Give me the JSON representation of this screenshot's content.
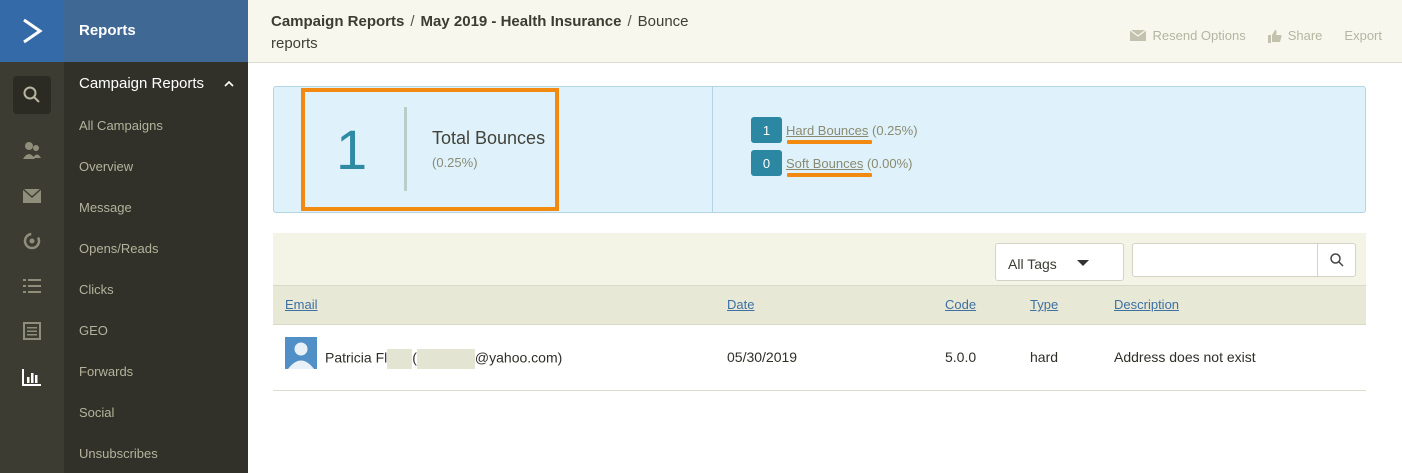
{
  "app": {
    "logo_icon": "chevron-right-logo",
    "accent_color": "#356aa8",
    "highlight_color": "#f28a12"
  },
  "rail": {
    "icons": [
      "search-icon",
      "contacts-icon",
      "mail-icon",
      "automation-icon",
      "list-icon",
      "forms-icon",
      "reports-icon"
    ]
  },
  "sidebar": {
    "title": "Reports",
    "section_label": "Campaign Reports",
    "items": [
      {
        "label": "All Campaigns"
      },
      {
        "label": "Overview"
      },
      {
        "label": "Message"
      },
      {
        "label": "Opens/Reads"
      },
      {
        "label": "Clicks"
      },
      {
        "label": "GEO"
      },
      {
        "label": "Forwards"
      },
      {
        "label": "Social"
      },
      {
        "label": "Unsubscribes"
      }
    ]
  },
  "header": {
    "breadcrumb": {
      "first": "Campaign Reports",
      "second": "May 2019 - Health Insurance",
      "third": "Bounce reports",
      "separator": "/"
    },
    "actions": {
      "resend": "Resend Options",
      "share": "Share",
      "export": "Export"
    }
  },
  "summary": {
    "total_count": "1",
    "total_label": "Total Bounces",
    "total_pct": "(0.25%)",
    "hard_count": "1",
    "hard_label": "Hard Bounces",
    "hard_pct": "(0.25%)",
    "soft_count": "0",
    "soft_label": "Soft Bounces",
    "soft_pct": "(0.00%)"
  },
  "filters": {
    "tags_selected": "All Tags",
    "search_value": ""
  },
  "table": {
    "columns": {
      "email": "Email",
      "date": "Date",
      "code": "Code",
      "type": "Type",
      "description": "Description"
    },
    "rows": [
      {
        "name_prefix": "Patricia Fl",
        "paren_open": "(",
        "email_suffix": "@yahoo.com)",
        "date": "05/30/2019",
        "code": "5.0.0",
        "type": "hard",
        "description": "Address does not exist"
      }
    ]
  }
}
